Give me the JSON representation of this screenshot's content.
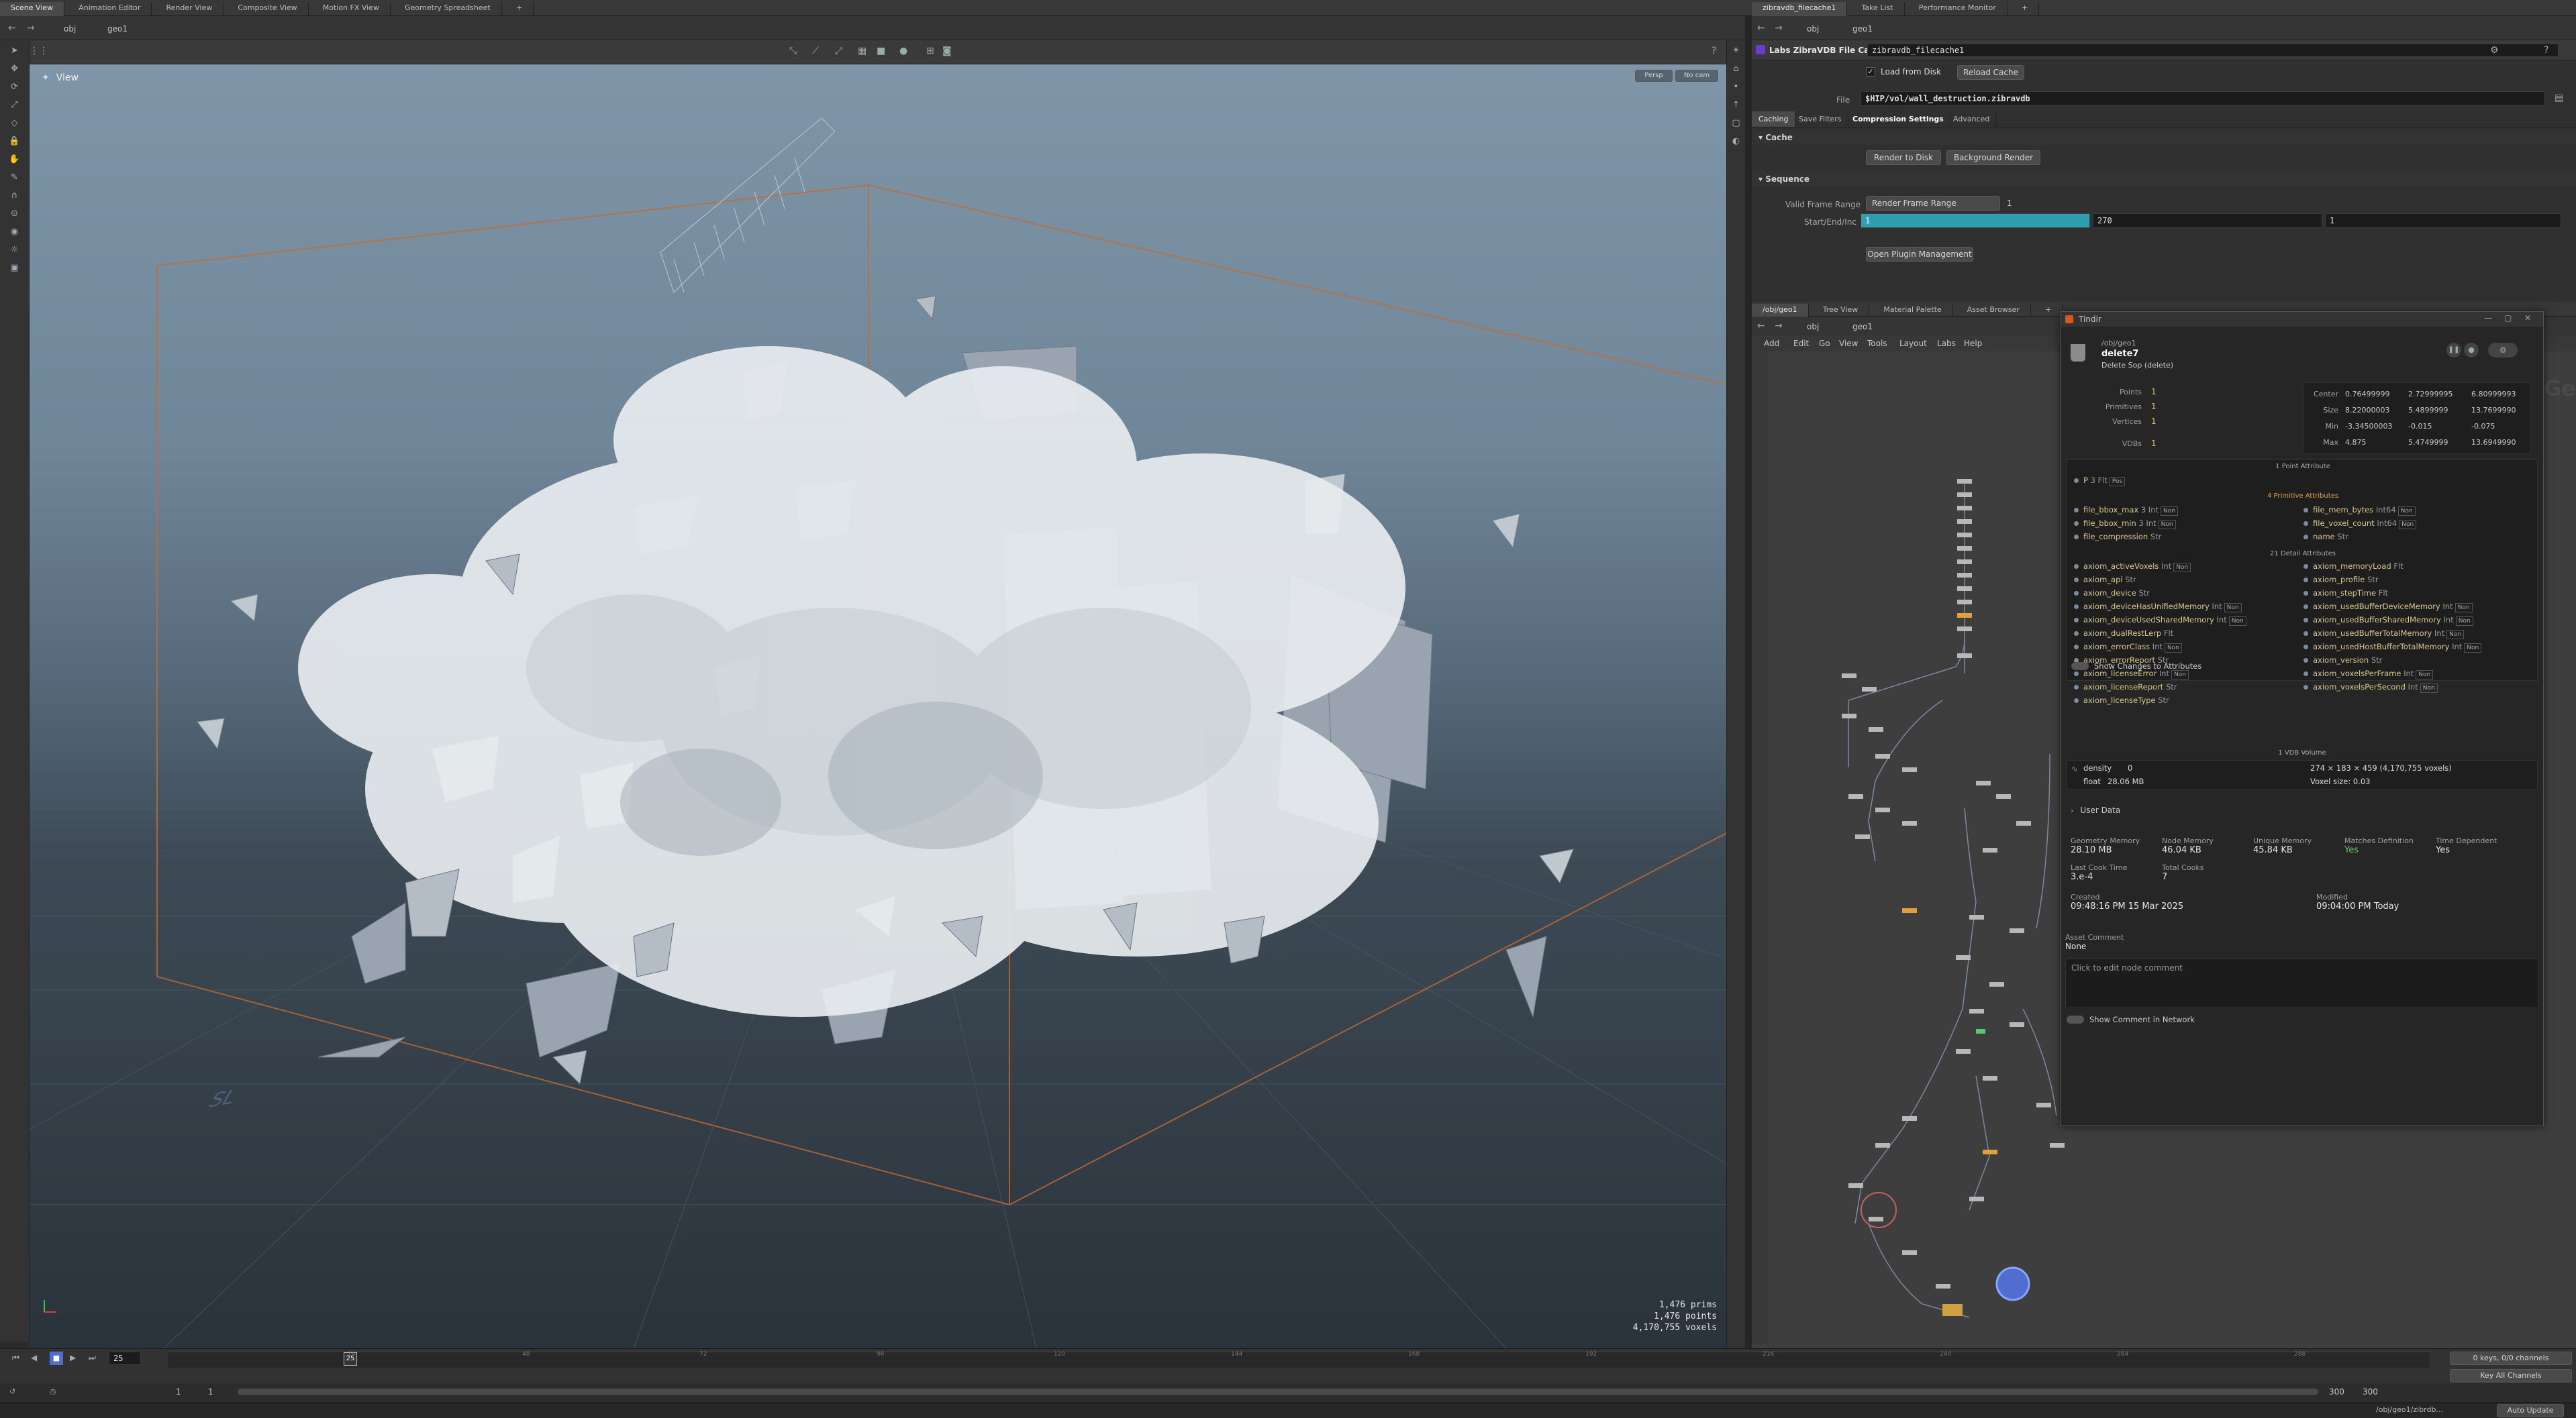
{
  "top_tabs_left": [
    "Scene View",
    "Animation Editor",
    "Render View",
    "Composite View",
    "Motion FX View",
    "Geometry Spreadsheet"
  ],
  "top_tabs_right": [
    "zibravdb_filecache1",
    "Take List",
    "Performance Monitor"
  ],
  "left_path": {
    "obj": "obj",
    "geo": "geo1"
  },
  "right_path": {
    "obj": "obj",
    "geo": "geo1"
  },
  "viewport": {
    "label": "View",
    "persp": "Persp",
    "cam": "No cam",
    "stats": [
      "1,476  prims",
      "1,476 points",
      "4,170,755 voxels"
    ],
    "ground_label": "SL"
  },
  "param": {
    "node_type": "Labs ZibraVDB File Cache",
    "node_name": "zibravdb_filecache1",
    "load_from_disk": "Load from Disk",
    "reload_cache": "Reload Cache",
    "file_label": "File",
    "file_value": "$HIP/vol/wall_destruction.zibravdb",
    "tabs": [
      "Caching",
      "Save Filters",
      "Compression Settings",
      "Advanced"
    ],
    "cache_section": "Cache",
    "render_to_disk": "Render to Disk",
    "background_render": "Background Render",
    "sequence_section": "Sequence",
    "valid_frame_range_label": "Valid Frame Range",
    "valid_frame_range_value": "Render Frame Range",
    "valid_frame_range_num": "1",
    "start_end_inc_label": "Start/End/Inc",
    "start": "1",
    "end": "270",
    "inc": "1",
    "open_plugin": "Open Plugin Management"
  },
  "network": {
    "tabs": [
      "/obj/geo1",
      "Tree View",
      "Material Palette",
      "Asset Browser"
    ],
    "menu": [
      "Add",
      "Edit",
      "Go",
      "View",
      "Tools",
      "Layout",
      "Labs",
      "Help"
    ],
    "watermark": "Geometry"
  },
  "info": {
    "window_title": "Tindir",
    "path": "/obj/geo1",
    "node_name": "delete7",
    "node_type": "Delete Sop (delete)",
    "counts": [
      {
        "label": "Points",
        "value": "1"
      },
      {
        "label": "Primitives",
        "value": "1"
      },
      {
        "label": "Vertices",
        "value": "1"
      },
      {
        "label": "VDBs",
        "value": "1"
      }
    ],
    "bbox_rows": [
      {
        "label": "Center",
        "v": [
          "0.76499999",
          "2.72999995",
          "6.80999993"
        ]
      },
      {
        "label": "Size",
        "v": [
          "8.22000003",
          "5.4899999",
          "13.7699990"
        ]
      },
      {
        "label": "Min",
        "v": [
          "-3.34500003",
          "-0.015",
          "-0.075"
        ]
      },
      {
        "label": "Max",
        "v": [
          "4.875",
          "5.4749999",
          "13.6949990"
        ]
      }
    ],
    "point_attr_header": "1 Point Attribute",
    "point_attrs": [
      {
        "name": "P",
        "type": "3 Flt",
        "badge": "Pos"
      }
    ],
    "prim_attr_header": "4 Primitive Attributes",
    "prim_attrs_left": [
      {
        "name": "file_bbox_max",
        "type": "3 Int",
        "badge": "Non"
      },
      {
        "name": "file_bbox_min",
        "type": "3 Int",
        "badge": "Non"
      },
      {
        "name": "file_compression",
        "type": "Str",
        "badge": ""
      }
    ],
    "prim_attrs_right": [
      {
        "name": "file_mem_bytes",
        "type": "Int64",
        "badge": "Non"
      },
      {
        "name": "file_voxel_count",
        "type": "Int64",
        "badge": "Non"
      },
      {
        "name": "name",
        "type": "Str",
        "badge": ""
      }
    ],
    "detail_attr_header": "21 Detail Attributes",
    "detail_attrs_left": [
      {
        "name": "axiom_activeVoxels",
        "type": "Int",
        "badge": "Non"
      },
      {
        "name": "axiom_api",
        "type": "Str",
        "badge": ""
      },
      {
        "name": "axiom_device",
        "type": "Str",
        "badge": ""
      },
      {
        "name": "axiom_deviceHasUnifiedMemory",
        "type": "Int",
        "badge": "Non"
      },
      {
        "name": "axiom_deviceUsedSharedMemory",
        "type": "Int",
        "badge": "Non"
      },
      {
        "name": "axiom_dualRestLerp",
        "type": "Flt",
        "badge": ""
      },
      {
        "name": "axiom_errorClass",
        "type": "Int",
        "badge": "Non"
      },
      {
        "name": "axiom_errorReport",
        "type": "Str",
        "badge": ""
      },
      {
        "name": "axiom_licenseError",
        "type": "Int",
        "badge": "Non"
      },
      {
        "name": "axiom_licenseReport",
        "type": "Str",
        "badge": ""
      },
      {
        "name": "axiom_licenseType",
        "type": "Str",
        "badge": ""
      }
    ],
    "detail_attrs_right": [
      {
        "name": "axiom_memoryLoad",
        "type": "Flt",
        "badge": ""
      },
      {
        "name": "axiom_profile",
        "type": "Str",
        "badge": ""
      },
      {
        "name": "axiom_stepTime",
        "type": "Flt",
        "badge": ""
      },
      {
        "name": "axiom_usedBufferDeviceMemory",
        "type": "Int",
        "badge": "Non"
      },
      {
        "name": "axiom_usedBufferSharedMemory",
        "type": "Int",
        "badge": "Non"
      },
      {
        "name": "axiom_usedBufferTotalMemory",
        "type": "Int",
        "badge": "Non"
      },
      {
        "name": "axiom_usedHostBufferTotalMemory",
        "type": "Int",
        "badge": "Non"
      },
      {
        "name": "axiom_version",
        "type": "Str",
        "badge": ""
      },
      {
        "name": "axiom_voxelsPerFrame",
        "type": "Int",
        "badge": "Non"
      },
      {
        "name": "axiom_voxelsPerSecond",
        "type": "Int",
        "badge": "Non"
      }
    ],
    "show_changes": "Show Changes to Attributes",
    "vdb_header": "1 VDB Volume",
    "vdb_name": "density",
    "vdb_index": "0",
    "vdb_dims": "274 × 183 × 459 (4,170,755 voxels)",
    "vdb_type": "float",
    "vdb_mem": "28.06 MB",
    "vdb_voxel_size": "Voxel size: 0.03",
    "user_data": "User Data",
    "stats": [
      {
        "label": "Geometry Memory",
        "value": "28.10 MB"
      },
      {
        "label": "Node Memory",
        "value": "46.04 KB"
      },
      {
        "label": "Unique Memory",
        "value": "45.84 KB"
      },
      {
        "label": "Matches Definition",
        "value": "Yes"
      },
      {
        "label": "Time Dependent",
        "value": "Yes"
      }
    ],
    "cook_time_label": "Last Cook Time",
    "cook_time": "3.e-4",
    "total_cooks_label": "Total Cooks",
    "total_cooks": "7",
    "created_label": "Created",
    "created": "09:48:16 PM 15 Mar 2025",
    "modified_label": "Modified",
    "modified": "09:04:00 PM Today",
    "asset_comment_label": "Asset Comment",
    "asset_comment": "None",
    "comment_placeholder": "Click to edit node comment",
    "show_comment": "Show Comment in Network"
  },
  "timeline": {
    "frame": "25",
    "range_start": "1",
    "range_start2": "1",
    "range_end": "300",
    "range_end2": "300",
    "ticks": [
      "24",
      "48",
      "72",
      "96",
      "120",
      "144",
      "168",
      "192",
      "216",
      "240",
      "264",
      "288"
    ],
    "keys": "0 keys, 0/0 channels",
    "key_all": "Key All Channels",
    "status_path": "/obj/geo1/zibrdb...",
    "auto_update": "Auto Update"
  },
  "colors": {
    "accent": "#e8a030",
    "selected_blue": "#4f6ecf",
    "frame_field": "#2f9fb0"
  }
}
